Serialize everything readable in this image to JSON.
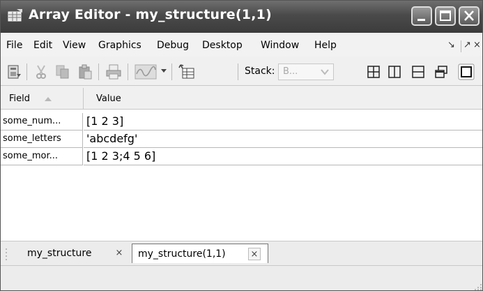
{
  "window": {
    "title": "Array Editor - my_structure(1,1)",
    "icon": "array-editor-icon",
    "controls": [
      "minimize-icon",
      "maximize-icon",
      "close-icon"
    ]
  },
  "menu": {
    "items": [
      "File",
      "Edit",
      "View",
      "Graphics",
      "Debug",
      "Desktop",
      "Window",
      "Help"
    ],
    "dock_label": "↘",
    "undock_label": "↗",
    "close_label": "×"
  },
  "toolbar": {
    "icons": [
      "import-data-icon",
      "cut-icon",
      "copy-icon",
      "paste-icon",
      "print-icon",
      "plot-icon",
      "plot-dropdown-icon",
      "new-variable-icon",
      "tile-grid-icon",
      "split-columns-icon",
      "split-rows-icon",
      "float-icon",
      "maximize-pane-icon"
    ],
    "stack_label": "Stack:",
    "stack_value": "B..."
  },
  "table": {
    "headers": {
      "field": "Field",
      "value": "Value"
    },
    "rows": [
      {
        "field": "some_num...",
        "value": "[1 2 3]"
      },
      {
        "field": "some_letters",
        "value": "'abcdefg'"
      },
      {
        "field": "some_mor...",
        "value": "[1 2 3;4 5 6]"
      }
    ]
  },
  "tabs": [
    {
      "label": "my_structure",
      "close": "×",
      "active": false
    },
    {
      "label": "my_structure(1,1)",
      "close": "×",
      "active": true
    }
  ],
  "colors": {
    "title_bar": "#4a4a4a",
    "active_tab_bg": "#ffffff",
    "grid_line": "#b8b8b8"
  }
}
